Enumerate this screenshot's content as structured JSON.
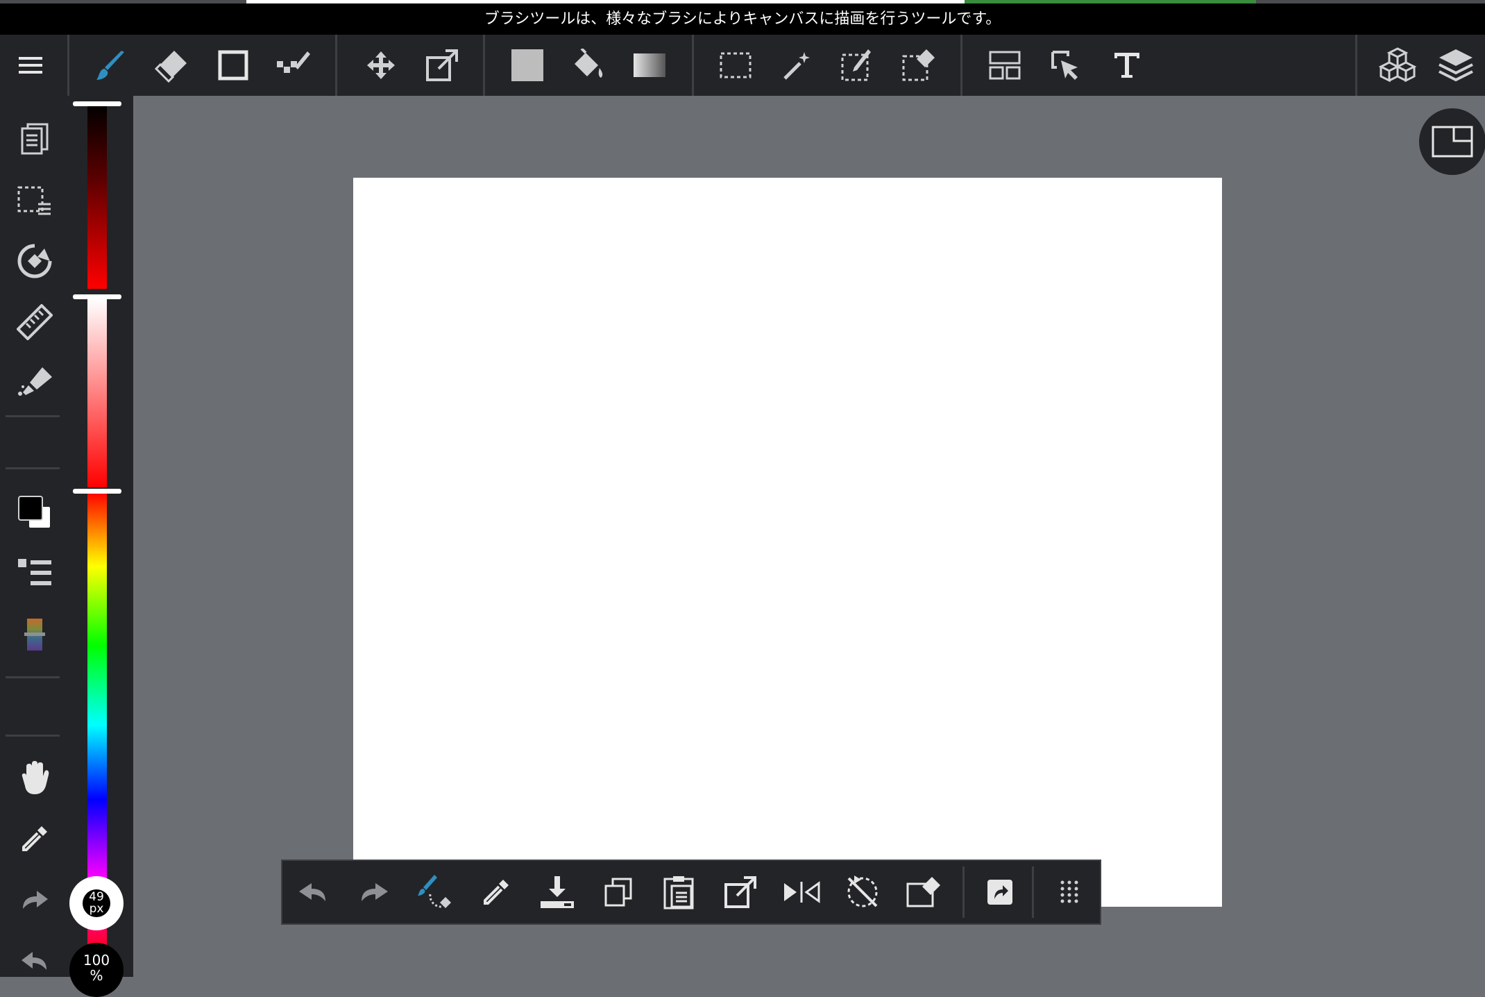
{
  "tip": {
    "text": "ブラシツールは、様々なブラシによりキャンバスに描画を行うツールです。"
  },
  "colors": {
    "accent": "#2f8fc0",
    "toolbar_bg": "#232427",
    "canvas_area_bg": "#6b6e73",
    "icon": "#cfd0d2",
    "foreground_color": "#000000",
    "background_color": "#ffffff"
  },
  "toolbar": {
    "menu_icon": "hamburger-menu-icon",
    "tools": [
      "brush-tool",
      "eraser-tool",
      "rectangle-tool",
      "dot-pen-tool",
      "move-tool",
      "transform-tool",
      "fill-color-tool",
      "bucket-tool",
      "gradient-tool",
      "select-rect-tool",
      "magic-wand-tool",
      "select-pen-tool",
      "select-eraser-tool",
      "frame-divide-tool",
      "operation-tool",
      "text-tool"
    ],
    "selected_tool": "brush-tool",
    "right": [
      "3d-material-icon",
      "layers-icon"
    ]
  },
  "leftrail": {
    "items": [
      "pages-icon",
      "selection-list-icon",
      "rotate-icon",
      "ruler-icon",
      "brush-settings-icon",
      "color-swatch-icon",
      "color-list-icon",
      "color-palette-icon",
      "hand-icon",
      "eyedropper-icon",
      "redo-icon",
      "undo-icon"
    ]
  },
  "sliders": {
    "brightness_level": 1.0,
    "saturation_level": 1.0,
    "hue_level": 0.0
  },
  "brush": {
    "size_value": "49",
    "size_unit": "px"
  },
  "zoom": {
    "value": "100",
    "unit": "%"
  },
  "bottombar": {
    "items": [
      "undo-icon",
      "redo-icon",
      "brush-eraser-toggle-icon",
      "eyedropper-icon",
      "save-icon",
      "copy-icon",
      "paste-icon",
      "transform-icon",
      "flip-icon",
      "rotate-reset-icon",
      "selection-clear-icon",
      "share-icon",
      "more-grid-icon"
    ]
  }
}
